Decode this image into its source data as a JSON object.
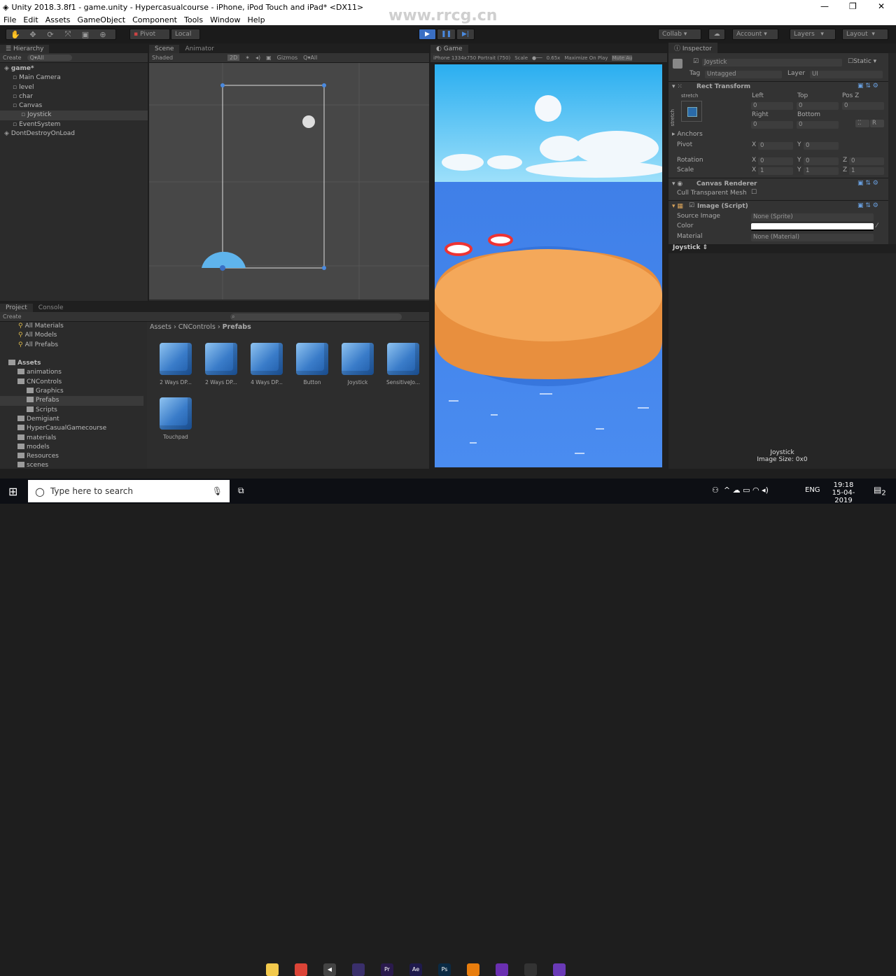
{
  "window": {
    "title": "Unity 2018.3.8f1 - game.unity - Hypercasualcourse - iPhone, iPod Touch and iPad* <DX11>"
  },
  "menu": [
    "File",
    "Edit",
    "Assets",
    "GameObject",
    "Component",
    "Tools",
    "Window",
    "Help"
  ],
  "toolbar": {
    "pivot": "Pivot",
    "local": "Local",
    "collab": "Collab",
    "account": "Account",
    "layers": "Layers",
    "layout": "Layout",
    "tools": [
      "hand-icon",
      "move-icon",
      "rotate-icon",
      "scale-icon",
      "rect-icon",
      "transform-icon"
    ]
  },
  "watermark": "www.rrcg.cn",
  "hierarchy": {
    "tab": "Hierarchy",
    "create": "Create",
    "search": "Q▾All",
    "items": [
      {
        "label": "game*",
        "depth": 0,
        "bold": true
      },
      {
        "label": "Main Camera",
        "depth": 1
      },
      {
        "label": "level",
        "depth": 1
      },
      {
        "label": "char",
        "depth": 1
      },
      {
        "label": "Canvas",
        "depth": 1
      },
      {
        "label": "Joystick",
        "depth": 2,
        "selected": true
      },
      {
        "label": "EventSystem",
        "depth": 1
      },
      {
        "label": "DontDestroyOnLoad",
        "depth": 0
      }
    ]
  },
  "scene": {
    "tabs": [
      "Scene",
      "Animator"
    ],
    "shading": "Shaded",
    "mode2d": "2D",
    "gizmos": "Gizmos",
    "search": "Q▾All"
  },
  "game": {
    "tab": "Game",
    "resolution": "iPhone 1334x750 Portrait (750)",
    "scale_label": "Scale",
    "scale": "0.65x",
    "maximize": "Maximize On Play",
    "mute": "Mute Au"
  },
  "inspector": {
    "tab": "Inspector",
    "name": "Joystick",
    "static": "Static",
    "tag_label": "Tag",
    "tag": "Untagged",
    "layer_label": "Layer",
    "layer": "UI",
    "rect": {
      "title": "Rect Transform",
      "stretch_h": "stretch",
      "stretch_v": "stretch",
      "left": "Left",
      "top": "Top",
      "posz": "Pos Z",
      "left_v": "0",
      "top_v": "0",
      "posz_v": "0",
      "right": "Right",
      "bottom": "Bottom",
      "right_v": "0",
      "bottom_v": "0",
      "r_btn": "R",
      "anchors": "Anchors",
      "pivot": "Pivot",
      "pivot_x": "0",
      "pivot_y": "0",
      "rotation": "Rotation",
      "rot": [
        "0",
        "0",
        "0"
      ],
      "scale": "Scale",
      "scl": [
        "1",
        "1",
        "1"
      ]
    },
    "canvas_renderer": {
      "title": "Canvas Renderer",
      "cull": "Cull Transparent Mesh"
    },
    "image": {
      "title": "Image (Script)",
      "source_label": "Source Image",
      "source": "None (Sprite)",
      "color_label": "Color",
      "color": "#ffffff",
      "material_label": "Material",
      "material": "None (Material)"
    },
    "preview_header": "Joystick ⇕",
    "preview_name": "Joystick",
    "image_size": "Image Size: 0x0"
  },
  "project": {
    "tabs": [
      "Project",
      "Console"
    ],
    "create": "Create",
    "favorites": [
      "All Materials",
      "All Models",
      "All Prefabs"
    ],
    "tree": [
      {
        "label": "Assets",
        "depth": 0,
        "bold": true
      },
      {
        "label": "animations",
        "depth": 1
      },
      {
        "label": "CNControls",
        "depth": 1
      },
      {
        "label": "Graphics",
        "depth": 2
      },
      {
        "label": "Prefabs",
        "depth": 2,
        "selected": true
      },
      {
        "label": "Scripts",
        "depth": 2
      },
      {
        "label": "Demigiant",
        "depth": 1
      },
      {
        "label": "HyperCasualGamecourse",
        "depth": 1
      },
      {
        "label": "materials",
        "depth": 1
      },
      {
        "label": "models",
        "depth": 1
      },
      {
        "label": "Resources",
        "depth": 1
      },
      {
        "label": "scenes",
        "depth": 1
      }
    ],
    "breadcrumb": [
      "Assets",
      "CNControls",
      "Prefabs"
    ],
    "assets": [
      "2 Ways DP...",
      "2 Ways DP...",
      "4 Ways DP...",
      "Button",
      "Joystick",
      "SensitiveJo...",
      "Touchpad"
    ]
  },
  "taskbar": {
    "search": "Type here to search",
    "lang": "ENG",
    "time": "19:18",
    "date": "15-04-2019",
    "notif": "2",
    "apps": [
      {
        "name": "file-explorer-icon",
        "label": "",
        "color": "#f2c94c"
      },
      {
        "name": "chrome-icon",
        "label": "",
        "color": "#db4437"
      },
      {
        "name": "unity-icon",
        "label": "◀",
        "color": "#444"
      },
      {
        "name": "premiere-icon-1",
        "label": "",
        "color": "#3a2f6b"
      },
      {
        "name": "premiere-icon",
        "label": "Pr",
        "color": "#2a1a4d"
      },
      {
        "name": "after-effects-icon",
        "label": "Ae",
        "color": "#1f1a4d"
      },
      {
        "name": "photoshop-icon",
        "label": "Ps",
        "color": "#0a2a44"
      },
      {
        "name": "blender-icon",
        "label": "",
        "color": "#e87d0d"
      },
      {
        "name": "firefox-icon",
        "label": "",
        "color": "#6a2fb0"
      },
      {
        "name": "obs-icon",
        "label": "",
        "color": "#333"
      },
      {
        "name": "visual-studio-icon",
        "label": "",
        "color": "#6a3ab6"
      }
    ]
  }
}
